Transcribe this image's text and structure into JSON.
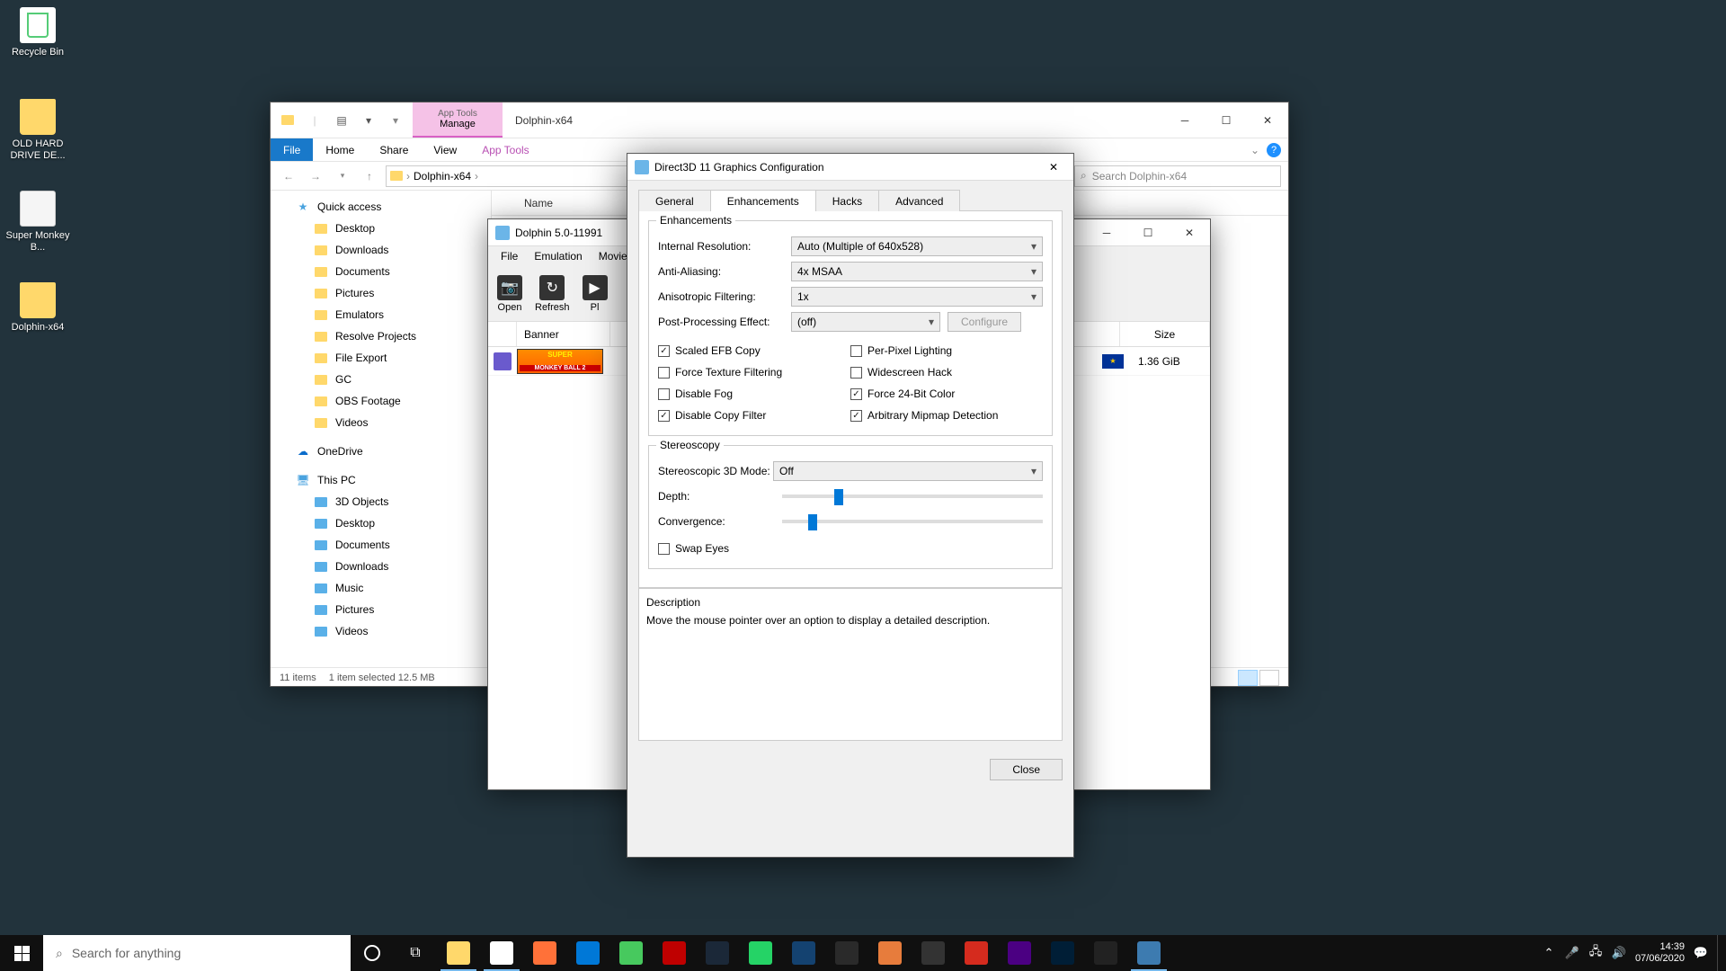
{
  "desktop": {
    "icons": [
      {
        "label": "Recycle Bin",
        "type": "bin"
      },
      {
        "label": "OLD HARD DRIVE DE...",
        "type": "folder"
      },
      {
        "label": "Super Monkey B...",
        "type": "doc"
      },
      {
        "label": "Dolphin-x64",
        "type": "folder"
      }
    ]
  },
  "explorer": {
    "context_tab": "Manage",
    "context_sub": "App Tools",
    "title": "Dolphin-x64",
    "ribbon": {
      "file": "File",
      "home": "Home",
      "share": "Share",
      "view": "View"
    },
    "breadcrumb": [
      "Dolphin-x64"
    ],
    "search_placeholder": "Search Dolphin-x64",
    "nav": {
      "quick": "Quick access",
      "quick_items": [
        "Desktop",
        "Downloads",
        "Documents",
        "Pictures",
        "Emulators",
        "Resolve Projects",
        "File Export",
        "GC",
        "OBS Footage",
        "Videos"
      ],
      "onedrive": "OneDrive",
      "thispc": "This PC",
      "pc_items": [
        "3D Objects",
        "Desktop",
        "Documents",
        "Downloads",
        "Music",
        "Pictures",
        "Videos"
      ]
    },
    "columns": {
      "name": "Name",
      "size": "Size"
    },
    "status": {
      "items": "11 items",
      "selected": "1 item selected  12.5 MB"
    }
  },
  "dolphin": {
    "title": "Dolphin 5.0-11991",
    "menu": [
      "File",
      "Emulation",
      "Movie"
    ],
    "toolbar": [
      {
        "label": "Open",
        "icon": "📷"
      },
      {
        "label": "Refresh",
        "icon": "↻"
      },
      {
        "label": "Pl",
        "icon": "▶"
      }
    ],
    "cols": {
      "banner": "Banner",
      "size": "Size"
    },
    "row": {
      "size": "1.36 GiB"
    }
  },
  "gfx": {
    "title": "Direct3D 11 Graphics Configuration",
    "tabs": [
      "General",
      "Enhancements",
      "Hacks",
      "Advanced"
    ],
    "active_tab": 1,
    "enhancements": {
      "group": "Enhancements",
      "internal_res": {
        "label": "Internal Resolution:",
        "value": "Auto (Multiple of 640x528)"
      },
      "aa": {
        "label": "Anti-Aliasing:",
        "value": "4x MSAA"
      },
      "aniso": {
        "label": "Anisotropic Filtering:",
        "value": "1x"
      },
      "pp": {
        "label": "Post-Processing Effect:",
        "value": "(off)",
        "configure": "Configure"
      },
      "checks": [
        {
          "label": "Scaled EFB Copy",
          "checked": true
        },
        {
          "label": "Per-Pixel Lighting",
          "checked": false
        },
        {
          "label": "Force Texture Filtering",
          "checked": false
        },
        {
          "label": "Widescreen Hack",
          "checked": false
        },
        {
          "label": "Disable Fog",
          "checked": false
        },
        {
          "label": "Force 24-Bit Color",
          "checked": true
        },
        {
          "label": "Disable Copy Filter",
          "checked": true
        },
        {
          "label": "Arbitrary Mipmap Detection",
          "checked": true
        }
      ]
    },
    "stereo": {
      "group": "Stereoscopy",
      "mode": {
        "label": "Stereoscopic 3D Mode:",
        "value": "Off"
      },
      "depth": {
        "label": "Depth:",
        "pos": 20
      },
      "convergence": {
        "label": "Convergence:",
        "pos": 10
      },
      "swap": {
        "label": "Swap Eyes",
        "checked": false
      }
    },
    "desc": {
      "title": "Description",
      "text": "Move the mouse pointer over an option to display a detailed description."
    },
    "close": "Close"
  },
  "taskbar": {
    "search": "Search for anything",
    "apps": [
      {
        "name": "task-view",
        "color": "transparent",
        "glyph": "⧉"
      },
      {
        "name": "explorer",
        "color": "#ffd86b",
        "active": true
      },
      {
        "name": "chrome",
        "color": "#fff",
        "active": true
      },
      {
        "name": "firefox",
        "color": "#ff7139"
      },
      {
        "name": "vscode",
        "color": "#0078d7"
      },
      {
        "name": "green-app",
        "color": "#47c95e"
      },
      {
        "name": "filezilla",
        "color": "#bf0000"
      },
      {
        "name": "steam",
        "color": "#1b2838"
      },
      {
        "name": "whatsapp",
        "color": "#25d366"
      },
      {
        "name": "media-player",
        "color": "#144270"
      },
      {
        "name": "davinci",
        "color": "#2a2a2a"
      },
      {
        "name": "orange-app",
        "color": "#e77c3c"
      },
      {
        "name": "clock-app",
        "color": "#333"
      },
      {
        "name": "mcd",
        "color": "#d52b1e"
      },
      {
        "name": "amazon-music",
        "color": "#4b0082"
      },
      {
        "name": "photoshop",
        "color": "#001e36"
      },
      {
        "name": "white-app",
        "color": "#222"
      },
      {
        "name": "dolphin",
        "color": "#3d7bb0",
        "active": true
      }
    ],
    "time": "14:39",
    "date": "07/06/2020"
  }
}
